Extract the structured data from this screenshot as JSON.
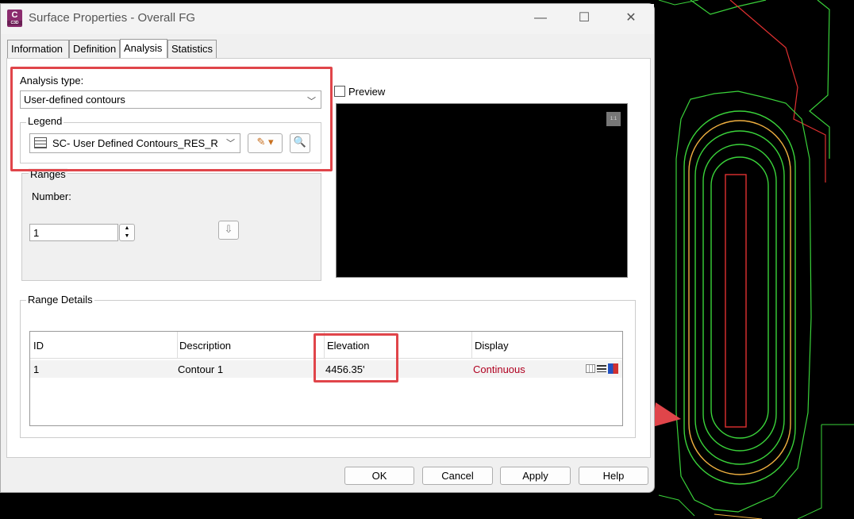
{
  "window": {
    "app_icon_letter": "C",
    "app_icon_sub": "C3D",
    "title": "Surface Properties - Overall FG",
    "minimize": "—",
    "maximize": "☐",
    "close": "✕"
  },
  "tabs": [
    {
      "label": "Information"
    },
    {
      "label": "Definition"
    },
    {
      "label": "Analysis"
    },
    {
      "label": "Statistics"
    }
  ],
  "analysis": {
    "type_label": "Analysis type:",
    "type_value": "User-defined contours",
    "legend_label": "Legend",
    "legend_value": "SC- User Defined Contours_RES_R",
    "ranges_label": "Ranges",
    "number_label": "Number:",
    "number_value": "1"
  },
  "preview": {
    "label": "Preview",
    "checked": false,
    "corner_icon": "1:1"
  },
  "range_details": {
    "title": "Range Details",
    "columns": [
      "ID",
      "Description",
      "Elevation",
      "Display"
    ],
    "rows": [
      {
        "id": "1",
        "description": "Contour 1",
        "elevation": "4456.35'",
        "display": "Continuous"
      }
    ]
  },
  "footer": {
    "ok": "OK",
    "cancel": "Cancel",
    "apply": "Apply",
    "help": "Help"
  },
  "colors": {
    "highlight": "#e0454a",
    "display_text": "#b00020",
    "contour_green": "#3ad33a",
    "contour_orange": "#f0b040",
    "contour_red": "#e03030"
  }
}
